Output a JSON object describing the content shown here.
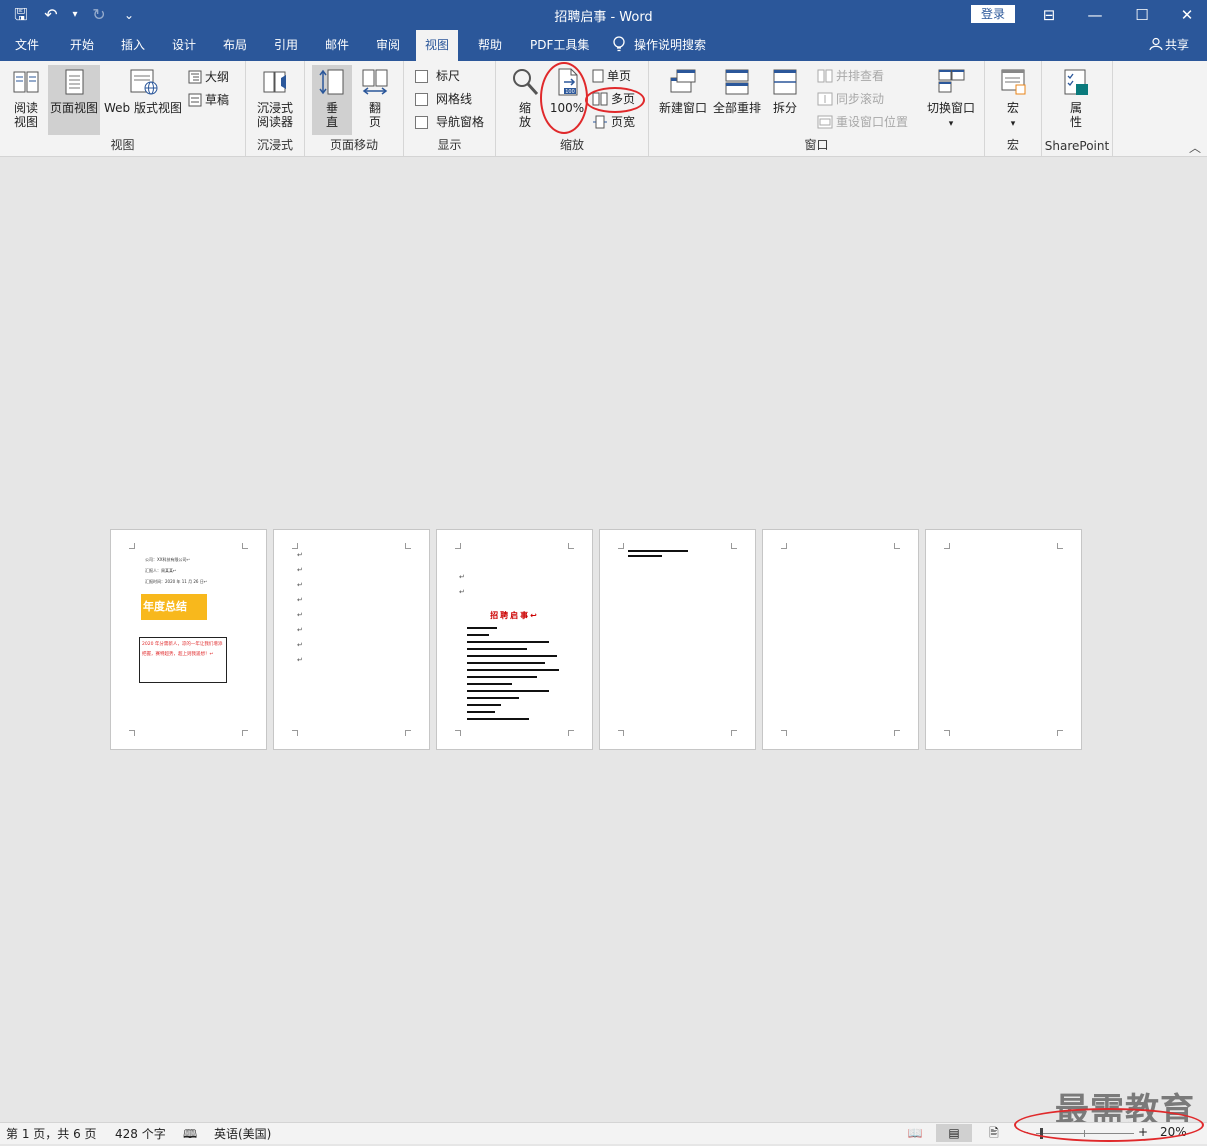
{
  "titlebar": {
    "title": "招聘启事  -  Word",
    "login": "登录",
    "qat_save": "🖫",
    "qat_undo": "↶",
    "qat_undo_arrow": "▾",
    "qat_redo": "↻",
    "qat_customize": "⌄",
    "ribbon_display_icon": "⊟",
    "minimize_icon": "—",
    "maximize_icon": "☐",
    "close_icon": "✕"
  },
  "tabs": [
    {
      "label": "文件"
    },
    {
      "label": "开始"
    },
    {
      "label": "插入"
    },
    {
      "label": "设计"
    },
    {
      "label": "布局"
    },
    {
      "label": "引用"
    },
    {
      "label": "邮件"
    },
    {
      "label": "审阅"
    },
    {
      "label": "视图"
    },
    {
      "label": "帮助"
    },
    {
      "label": "PDF工具集"
    },
    {
      "label": "操作说明搜索"
    }
  ],
  "share": "共享",
  "ribbon": {
    "groups": {
      "views": "视图",
      "immersive": "沉浸式",
      "page_move": "页面移动",
      "show": "显示",
      "zoom": "缩放",
      "window": "窗口",
      "macros": "宏",
      "sharepoint": "SharePoint"
    },
    "views": {
      "read_mode": "阅读\n视图",
      "print_layout": "页面视图",
      "web_layout": "Web 版式视图",
      "outline": "大纲",
      "draft": "草稿"
    },
    "immersive": {
      "reader": "沉浸式\n阅读器"
    },
    "page_move": {
      "vertical": "垂\n直",
      "side_to_side": "翻\n页"
    },
    "show": {
      "ruler": "标尺",
      "gridlines": "网格线",
      "nav_pane": "导航窗格"
    },
    "zoom": {
      "zoom": "缩\n放",
      "hundred": "100%",
      "hundred_badge": "100",
      "one_page": "单页",
      "multiple_pages": "多页",
      "page_width": "页宽"
    },
    "window": {
      "new_window": "新建窗口",
      "arrange_all": "全部重排",
      "split": "拆分",
      "view_side_by_side": "并排查看",
      "sync_scroll": "同步滚动",
      "reset_position": "重设窗口位置",
      "switch_windows": "切换窗口"
    },
    "macros": {
      "macros": "宏"
    },
    "sharepoint": {
      "properties": "属\n性"
    },
    "collapse_icon": "︿",
    "dropdown_arrow": "▾"
  },
  "document": {
    "page1": {
      "company": "公司：XX科技有限公司↩",
      "reporter": "汇报人：周某某↩",
      "date": "汇报时间：2020 年 11 月 26 日↩",
      "banner": "年度总结",
      "box_text": "2020 年分需新人，凉的一年让我们增添把握，赛特超势，超上则我遥想！↩",
      "accent_yellow": "#f8b81c",
      "accent_red": "#e0292b"
    },
    "page3": {
      "heading": "招聘启事↩"
    },
    "para_mark": "↵"
  },
  "statusbar": {
    "page": "第 1 页，共 6 页",
    "words": "428 个字",
    "proofing_icon": "🕮",
    "language": "英语(美国)",
    "zoom": "20%",
    "zoom_fraction": 0.2,
    "read_view_icon": "📖",
    "print_view_icon": "▤",
    "web_view_icon": "🖹",
    "zoom_out": "-",
    "zoom_in": "+"
  },
  "watermark": "最需教育",
  "colors": {
    "brand": "#2b579a",
    "highlight_ring": "#e0292b",
    "ribbon_bg": "#f3f3f3",
    "canvas_bg": "#e6e6e6"
  }
}
